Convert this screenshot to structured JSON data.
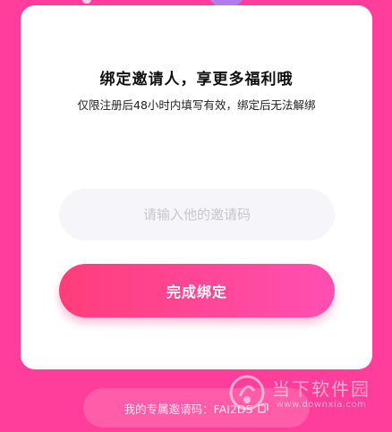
{
  "card": {
    "title": "绑定邀请人，享更多福利哦",
    "subtitle": "仅限注册后48小时内填写有效，绑定后无法解绑",
    "input_placeholder": "请输入他的邀请码",
    "input_value": "",
    "confirm_label": "完成绑定"
  },
  "footer": {
    "my_code_label": "我的专属邀请码：FAI2DS",
    "copy_icon": "copy-icon"
  },
  "watermark": {
    "name": "当下软件园",
    "url": "www.downxia.com"
  },
  "colors": {
    "background": "#ff3d9a",
    "button_start": "#ff3d7a",
    "button_end": "#ff4fb2",
    "input_bg": "#f6f6fa"
  }
}
